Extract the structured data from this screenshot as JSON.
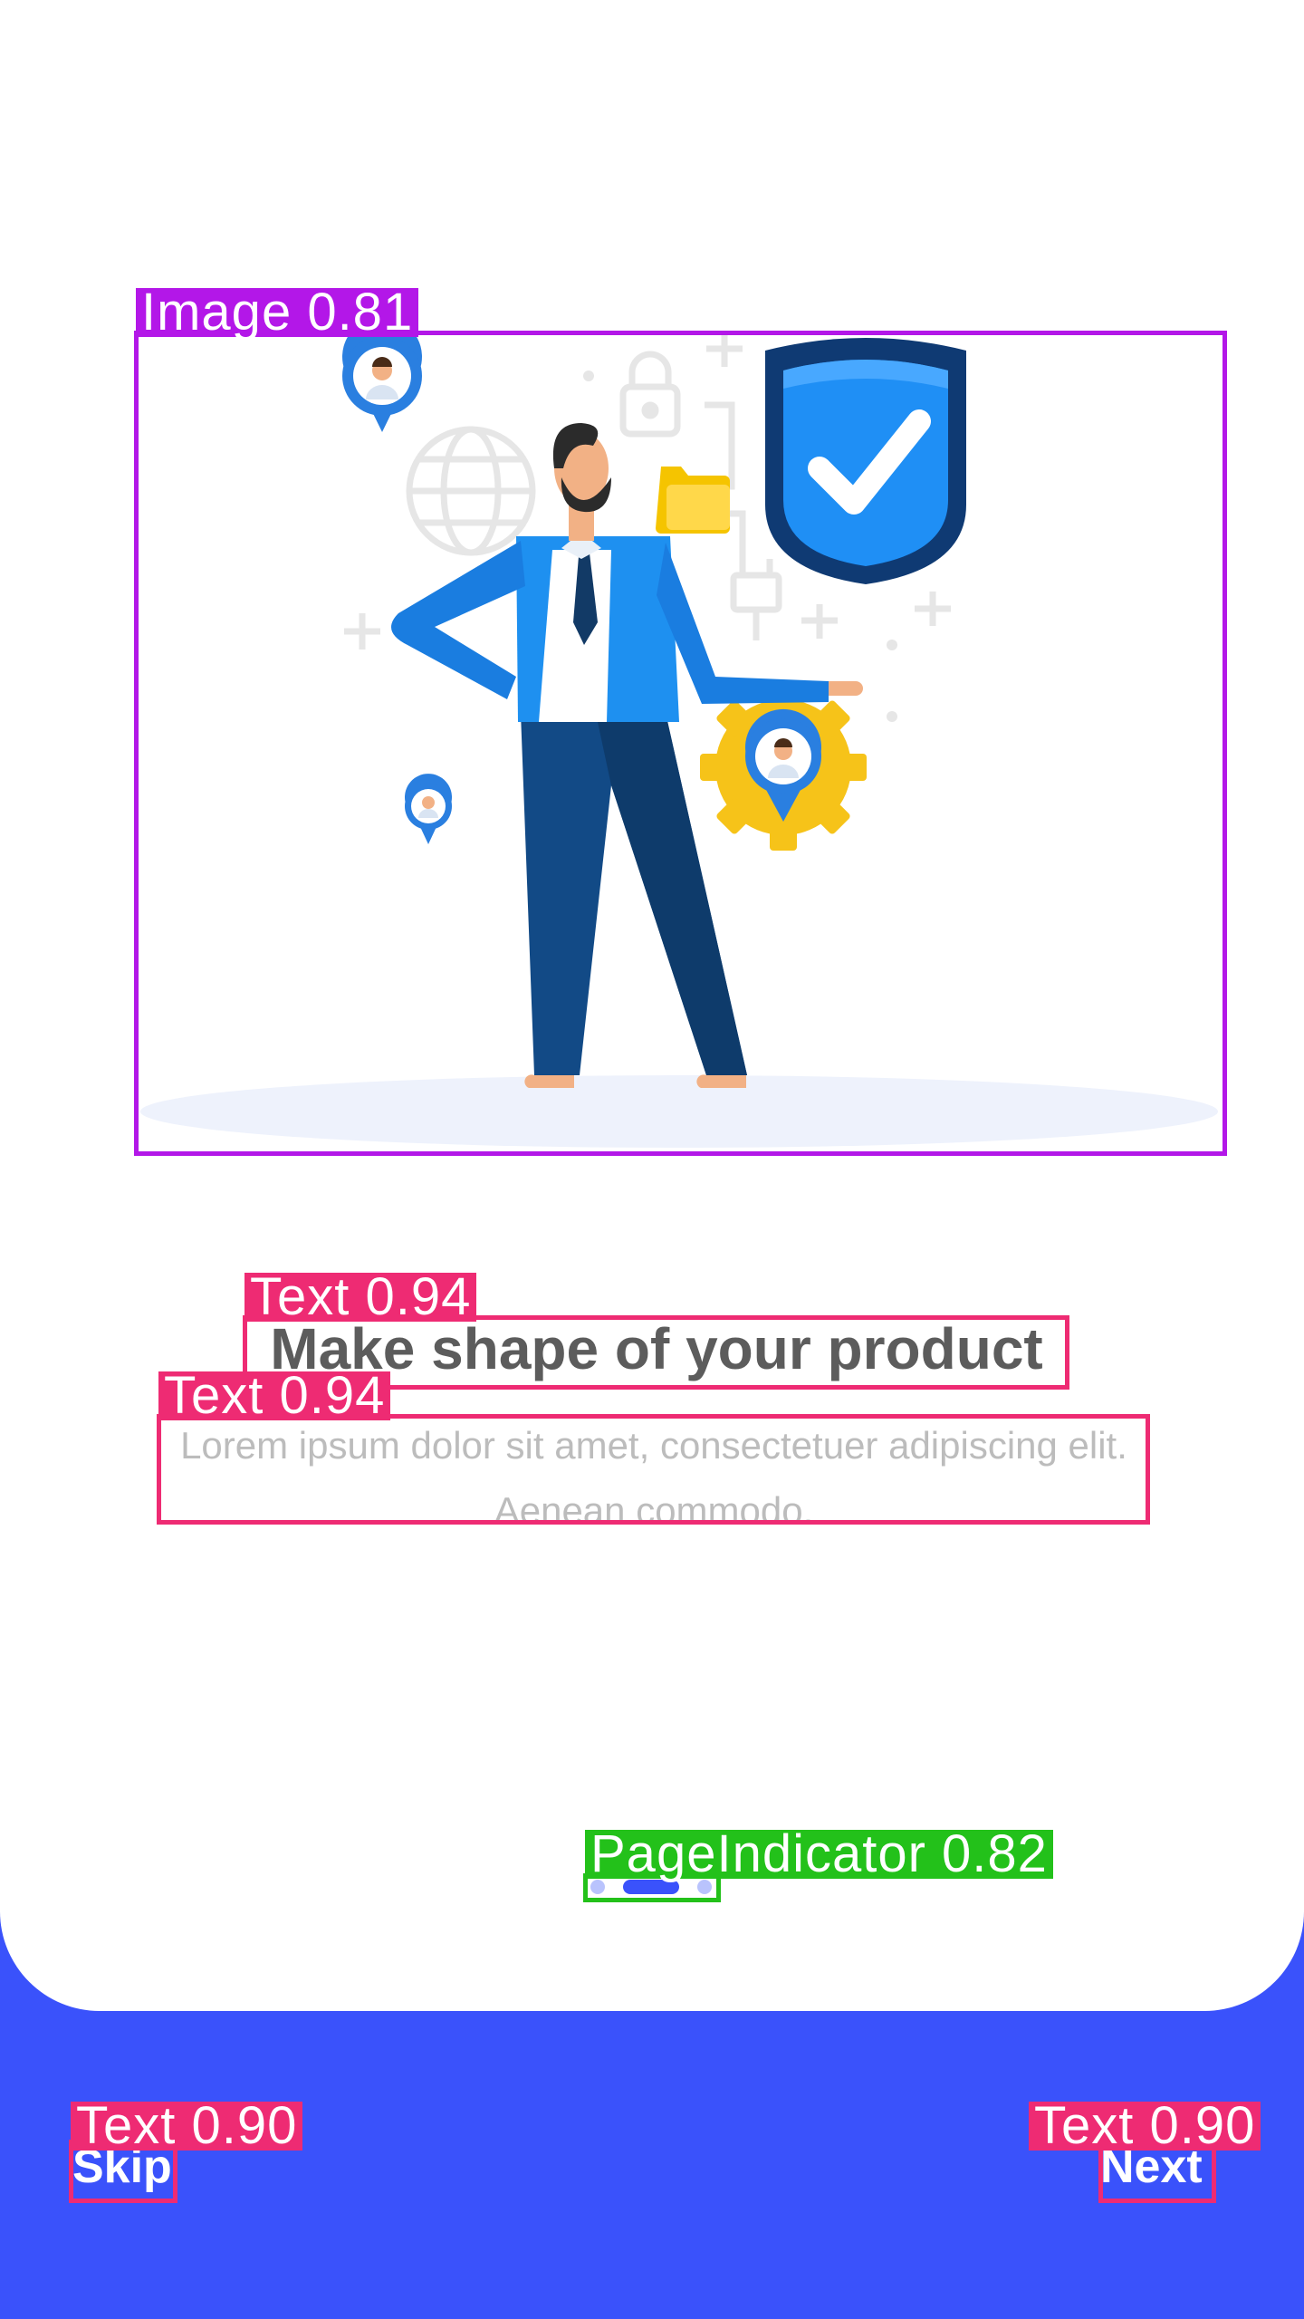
{
  "onboarding": {
    "title": "Make shape of your product",
    "description": "Lorem ipsum dolor sit amet, consectetuer adipiscing elit. Aenean commodo.",
    "page_indicator": {
      "count": 3,
      "active_index": 1
    },
    "skip_label": "Skip",
    "next_label": "Next"
  },
  "detections": {
    "image": "Image 0.81",
    "title_text": "Text 0.94",
    "description_text": "Text 0.94",
    "page_indicator": "PageIndicator 0.82",
    "skip_text": "Text 0.90",
    "next_text": "Text 0.90"
  },
  "colors": {
    "accent": "#3a52fb",
    "background": "#ffffff",
    "title": "#5c5c5c",
    "description": "#bcbcbc",
    "image_box": "#b317e8",
    "text_box": "#ee2b73",
    "indicator_box": "#23c11a"
  },
  "icons": [
    "shield-check-icon",
    "gear-icon",
    "location-pin-icon",
    "globe-icon",
    "padlock-icon",
    "folder-icon"
  ]
}
